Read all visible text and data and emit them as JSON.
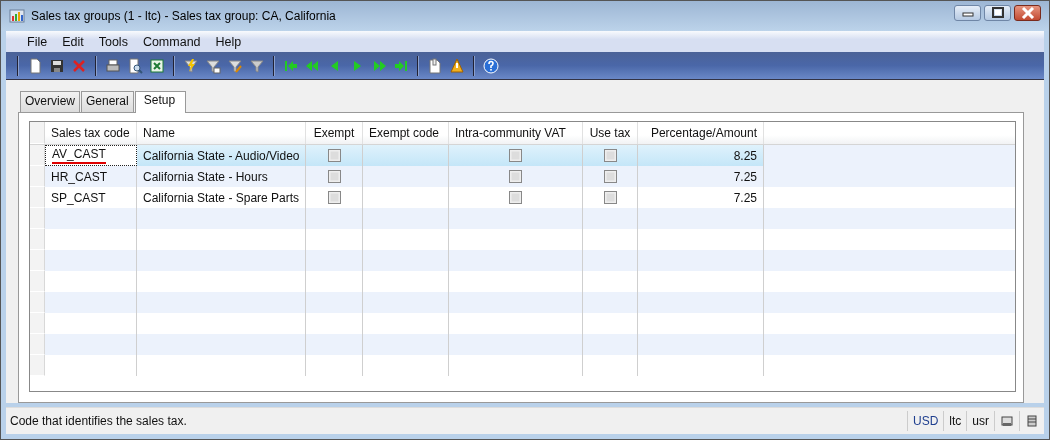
{
  "window": {
    "title": "Sales tax groups (1 - ltc) - Sales tax group: CA, California"
  },
  "menu": [
    "File",
    "Edit",
    "Tools",
    "Command",
    "Help"
  ],
  "tabs": [
    {
      "label": "Overview",
      "selected": false
    },
    {
      "label": "General",
      "selected": false
    },
    {
      "label": "Setup",
      "selected": true
    }
  ],
  "table": {
    "columns": [
      "Sales tax code",
      "Name",
      "Exempt",
      "Exempt code",
      "Intra-community VAT",
      "Use tax",
      "Percentage/Amount"
    ],
    "rows": [
      {
        "code": "AV_CAST",
        "name": "California State - Audio/Video",
        "exempt": false,
        "exempt_code": "",
        "intra_community_vat": false,
        "use_tax": false,
        "percentage": "8.25",
        "selected": true
      },
      {
        "code": "HR_CAST",
        "name": "California State - Hours",
        "exempt": false,
        "intra_community_vat": false,
        "use_tax": false,
        "percentage": "7.25",
        "selected": false
      },
      {
        "code": "SP_CAST",
        "name": "California State - Spare Parts",
        "exempt": false,
        "intra_community_vat": false,
        "use_tax": false,
        "percentage": "7.25",
        "selected": false
      }
    ]
  },
  "status_bar": {
    "message": "Code that identifies the sales tax.",
    "currency": "USD",
    "company": "ltc",
    "user": "usr"
  }
}
